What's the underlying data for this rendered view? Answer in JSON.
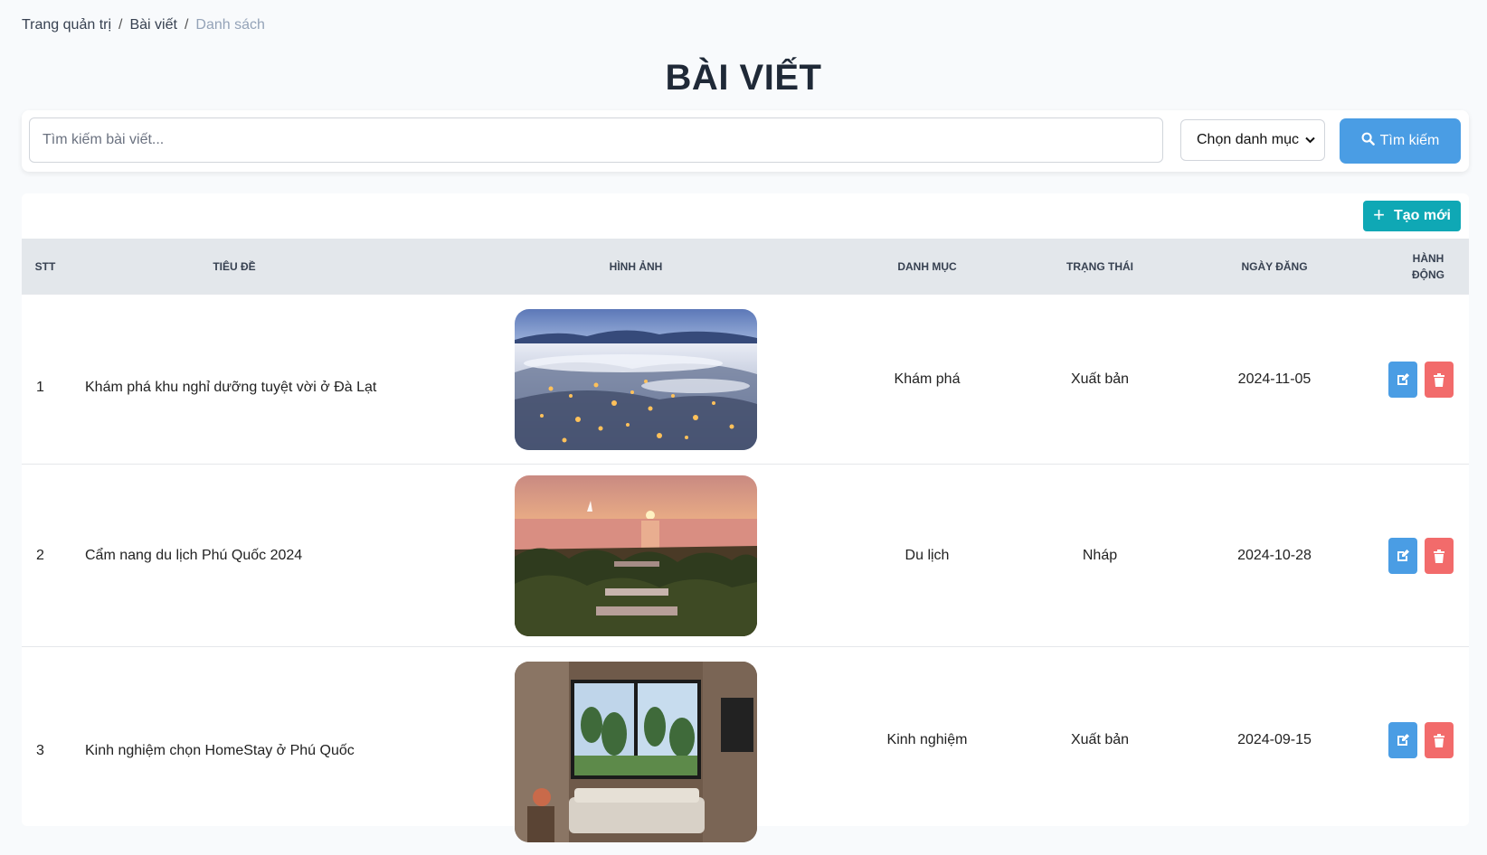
{
  "breadcrumb": {
    "home": "Trang quản trị",
    "section": "Bài viết",
    "current": "Danh sách"
  },
  "page": {
    "title": "BÀI VIẾT"
  },
  "search": {
    "placeholder": "Tìm kiếm bài viết...",
    "category_selected": "Chọn danh mục",
    "button_label": "Tìm kiếm"
  },
  "table": {
    "create_label": "Tạo mới",
    "columns": {
      "stt": "STT",
      "title": "TIÊU ĐỀ",
      "image": "HÌNH ẢNH",
      "category": "DANH MỤC",
      "status": "TRẠNG THÁI",
      "date": "NGÀY ĐĂNG",
      "actions": "HÀNH ĐỘNG"
    },
    "rows": [
      {
        "stt": "1",
        "title": "Khám phá khu nghỉ dưỡng tuyệt vời ở Đà Lạt",
        "image": "foggy-city-night-photo",
        "category": "Khám phá",
        "status": "Xuất bản",
        "date": "2024-11-05"
      },
      {
        "stt": "2",
        "title": "Cẩm nang du lịch Phú Quốc 2024",
        "image": "beach-resort-sunset-photo",
        "category": "Du lịch",
        "status": "Nháp",
        "date": "2024-10-28"
      },
      {
        "stt": "3",
        "title": "Kinh nghiệm chọn HomeStay ở Phú Quốc",
        "image": "hotel-room-window-photo",
        "category": "Kinh nghiệm",
        "status": "Xuất bản",
        "date": "2024-09-15"
      }
    ]
  },
  "icons": {
    "search": "magnifier-icon",
    "plus": "plus-icon",
    "edit": "pencil-square-icon",
    "delete": "trash-icon",
    "chevron": "chevron-down-icon"
  },
  "colors": {
    "primary": "#4a9de4",
    "create": "#0fa8b5",
    "danger": "#f26b6b",
    "header_bg": "#e3e7eb"
  }
}
